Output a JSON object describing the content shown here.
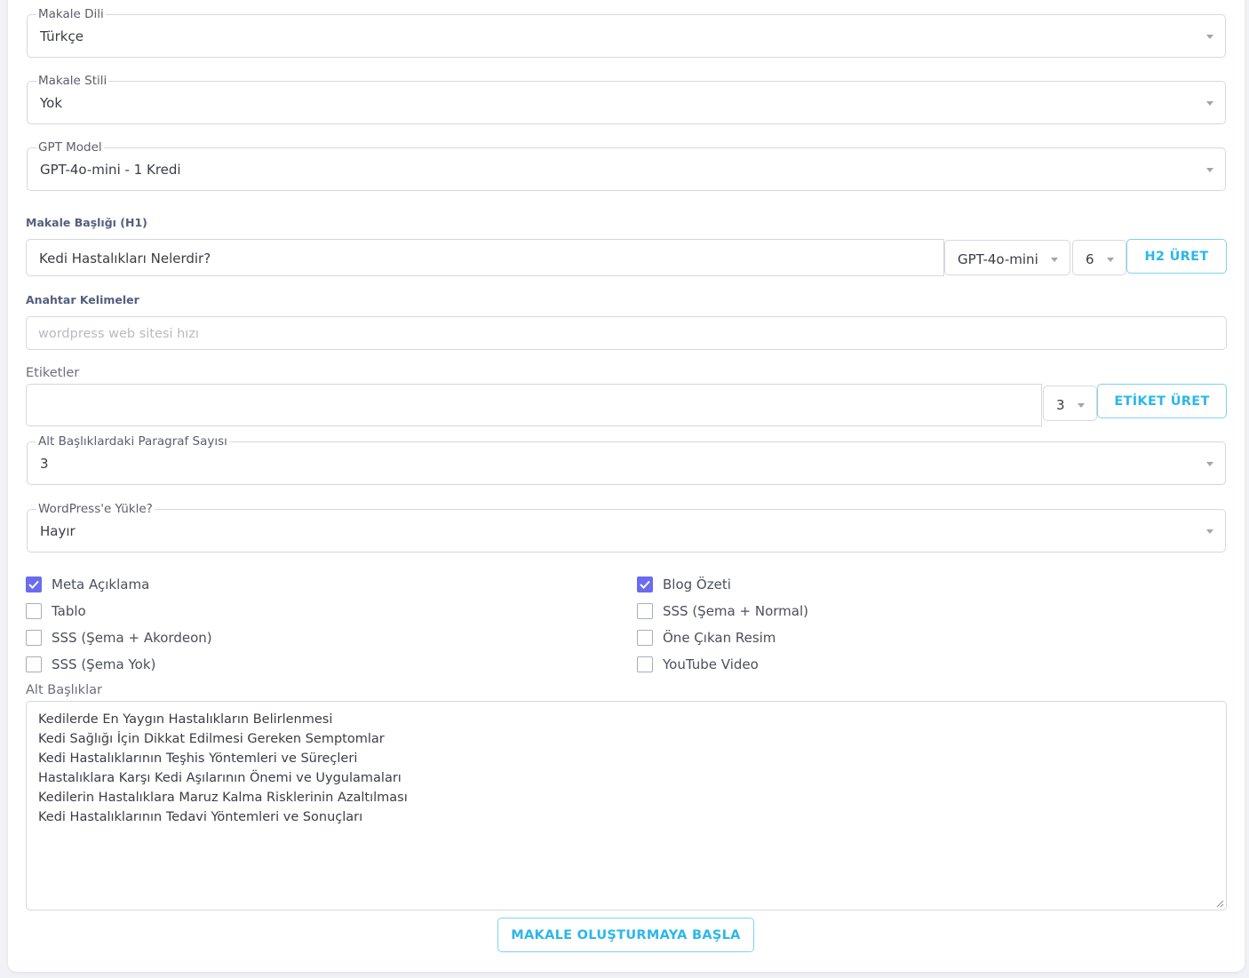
{
  "article_language": {
    "label": "Makale Dili",
    "value": "Türkçe"
  },
  "article_style": {
    "label": "Makale Stili",
    "value": "Yok"
  },
  "gpt_model": {
    "label": "GPT Model",
    "value": "GPT-4o-mini - 1 Kredi"
  },
  "title": {
    "label": "Makale Başlığı (H1)",
    "value": "Kedi Hastalıkları Nelerdir?",
    "model_value": "GPT-4o-mini",
    "count_value": "6",
    "button": "H2 ÜRET"
  },
  "keywords": {
    "label": "Anahtar Kelimeler",
    "placeholder": "wordpress web sitesi hızı"
  },
  "tags": {
    "label": "Etiketler",
    "value": "",
    "count_value": "3",
    "button": "ETİKET ÜRET"
  },
  "paragraph_count": {
    "label": "Alt Başlıklardaki Paragraf Sayısı",
    "value": "3"
  },
  "wordpress_upload": {
    "label": "WordPress'e Yükle?",
    "value": "Hayır"
  },
  "options_left": [
    {
      "label": "Meta Açıklama",
      "checked": true
    },
    {
      "label": "Tablo",
      "checked": false
    },
    {
      "label": "SSS (Şema + Akordeon)",
      "checked": false
    },
    {
      "label": "SSS (Şema Yok)",
      "checked": false
    }
  ],
  "options_right": [
    {
      "label": "Blog Özeti",
      "checked": true
    },
    {
      "label": "SSS (Şema + Normal)",
      "checked": false
    },
    {
      "label": "Öne Çıkan Resim",
      "checked": false
    },
    {
      "label": "YouTube Video",
      "checked": false
    }
  ],
  "subheadings": {
    "label": "Alt Başlıklar",
    "lines": [
      "Kedilerde En Yaygın Hastalıkların Belirlenmesi",
      "Kedi Sağlığı İçin Dikkat Edilmesi Gereken Semptomlar",
      "Kedi Hastalıklarının Teşhis Yöntemleri ve Süreçleri",
      "Hastalıklara Karşı Kedi Aşılarının Önemi ve Uygulamaları",
      "Kedilerin Hastalıklara Maruz Kalma Risklerinin Azaltılması",
      "Kedi Hastalıklarının Tedavi Yöntemleri ve Sonuçları"
    ]
  },
  "submit_button": "MAKALE OLUŞTURMAYA BAŞLA",
  "colors": {
    "accent": "#2bb7ea",
    "checkbox": "#6a6cf0"
  }
}
